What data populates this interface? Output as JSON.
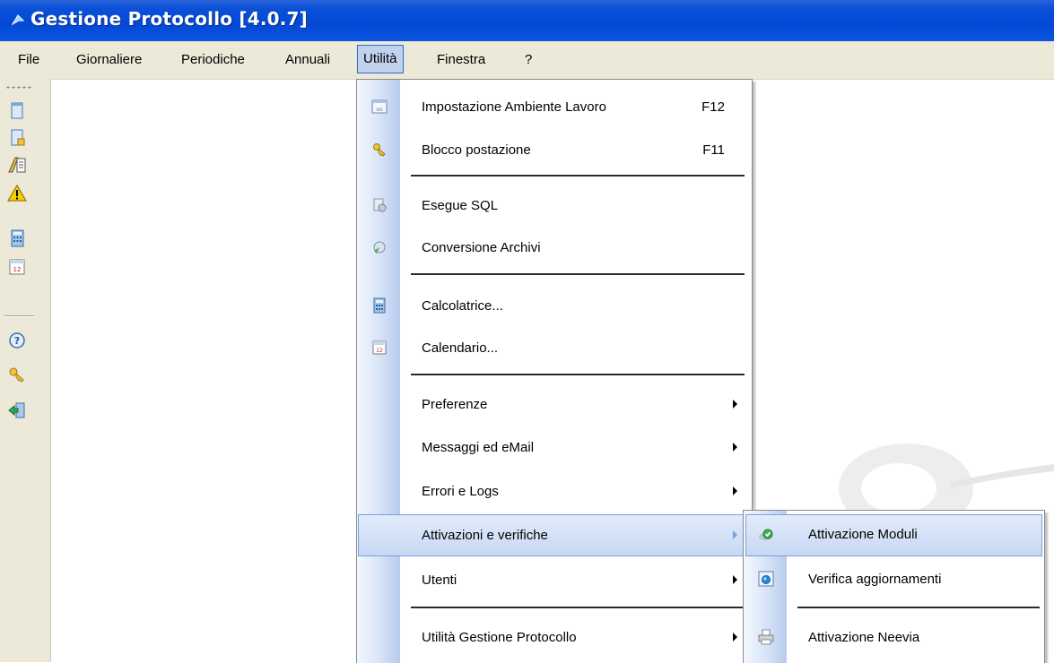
{
  "window": {
    "title": "Gestione Protocollo [4.0.7]"
  },
  "menubar": {
    "items": [
      {
        "label": "File"
      },
      {
        "label": "Giornaliere"
      },
      {
        "label": "Periodiche"
      },
      {
        "label": "Annuali"
      },
      {
        "label": "Utilità",
        "active": true
      },
      {
        "label": "Finestra"
      },
      {
        "label": "?"
      }
    ]
  },
  "toolbar": {
    "icons": [
      "document-icon",
      "document-lock-icon",
      "report-icon",
      "warning-icon",
      "calculator-icon",
      "calendar-icon",
      "help-icon",
      "key-icon",
      "exit-icon"
    ]
  },
  "utilita_menu": {
    "items": [
      {
        "label": "Impostazione Ambiente Lavoro",
        "shortcut": "F12",
        "icon": "window-settings-icon"
      },
      {
        "label": "Blocco postazione",
        "shortcut": "F11",
        "icon": "key-icon"
      },
      {
        "label": "Esegue SQL",
        "icon": "sql-icon"
      },
      {
        "label": "Conversione Archivi",
        "icon": "convert-icon"
      },
      {
        "label": "Calcolatrice...",
        "icon": "calculator-icon"
      },
      {
        "label": "Calendario...",
        "icon": "calendar-icon"
      },
      {
        "label": "Preferenze",
        "submenu": true
      },
      {
        "label": "Messaggi ed eMail",
        "submenu": true
      },
      {
        "label": "Errori e Logs",
        "submenu": true
      },
      {
        "label": "Attivazioni e verifiche",
        "submenu": true,
        "highlighted": true
      },
      {
        "label": "Utenti",
        "submenu": true
      },
      {
        "label": "Utilità Gestione Protocollo",
        "submenu": true
      }
    ]
  },
  "attivazioni_submenu": {
    "items": [
      {
        "label": "Attivazione Moduli",
        "icon": "check-module-icon",
        "highlighted": true
      },
      {
        "label": "Verifica aggiornamenti",
        "icon": "update-check-icon"
      },
      {
        "label": "Attivazione Neevia",
        "icon": "printer-icon"
      }
    ]
  },
  "colors": {
    "titlebar": "#0349d6",
    "menubar": "#ece9d8",
    "highlight": "#c6d8f4",
    "highlight_border": "#7a9fd9"
  }
}
